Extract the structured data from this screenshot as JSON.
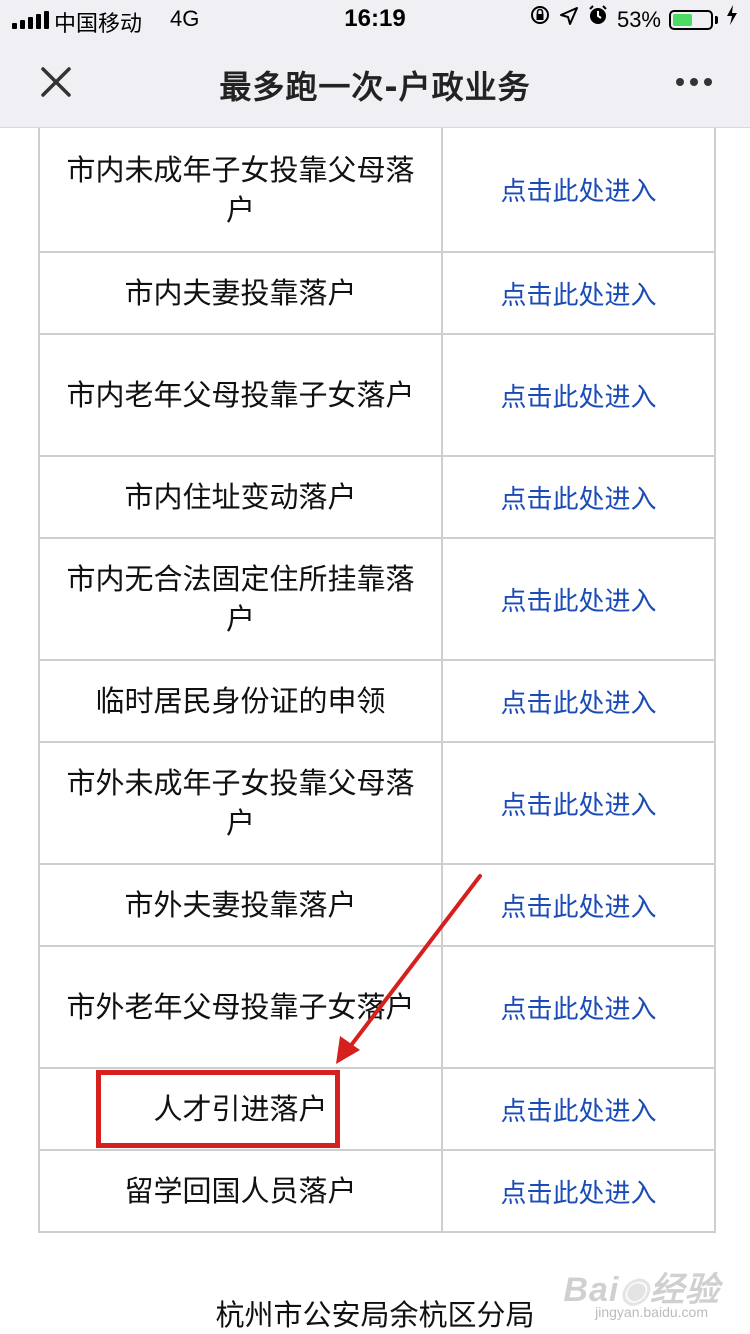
{
  "status_bar": {
    "carrier": "中国移动",
    "network": "4G",
    "time": "16:19",
    "battery_percent": "53%",
    "battery_level": 0.53,
    "battery_color": "#4cd964"
  },
  "nav": {
    "title": "最多跑一次-户政业务",
    "close_icon": "close-icon",
    "more_icon": "more-icon"
  },
  "rows": [
    {
      "name": "市内未成年子女投靠父母落户",
      "action": "点击此处进入"
    },
    {
      "name": "市内夫妻投靠落户",
      "action": "点击此处进入"
    },
    {
      "name": "市内老年父母投靠子女落户",
      "action": "点击此处进入"
    },
    {
      "name": "市内住址变动落户",
      "action": "点击此处进入"
    },
    {
      "name": "市内无合法固定住所挂靠落户",
      "action": "点击此处进入"
    },
    {
      "name": "临时居民身份证的申领",
      "action": "点击此处进入"
    },
    {
      "name": "市外未成年子女投靠父母落户",
      "action": "点击此处进入"
    },
    {
      "name": "市外夫妻投靠落户",
      "action": "点击此处进入"
    },
    {
      "name": "市外老年父母投靠子女落户",
      "action": "点击此处进入"
    },
    {
      "name": "人才引进落户",
      "action": "点击此处进入"
    },
    {
      "name": "留学回国人员落户",
      "action": "点击此处进入"
    }
  ],
  "footer": {
    "text": "杭州市公安局余杭区分局"
  },
  "watermark": {
    "brand": "Baidu经验",
    "url": "jingyan.baidu.com"
  },
  "colors": {
    "link": "#1b4bb6",
    "annotation": "#d6201d"
  }
}
